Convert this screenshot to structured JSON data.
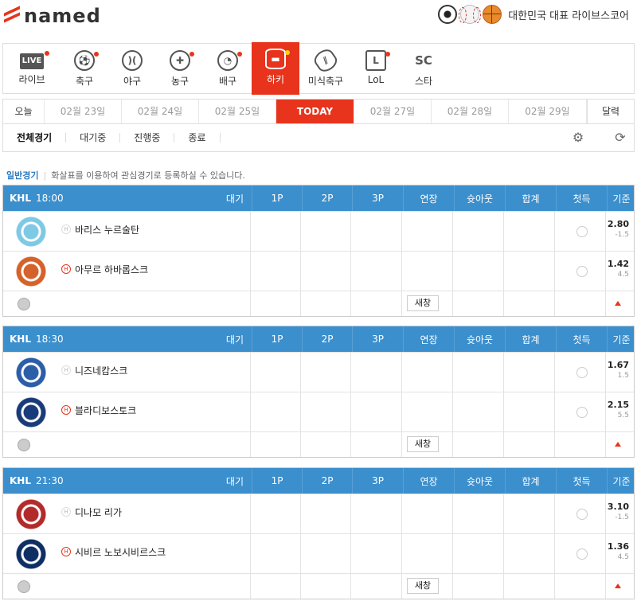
{
  "brand": {
    "logo": "named",
    "tagline": "대한민국 대표 라이브스코어"
  },
  "sports": [
    {
      "label": "라이브",
      "icon": "live-icon",
      "dot": true
    },
    {
      "label": "축구",
      "icon": "soccer-icon",
      "dot": true
    },
    {
      "label": "야구",
      "icon": "baseball-icon",
      "dot": false
    },
    {
      "label": "농구",
      "icon": "basketball-icon",
      "dot": true
    },
    {
      "label": "배구",
      "icon": "volleyball-icon",
      "dot": true
    },
    {
      "label": "하키",
      "icon": "hockey-icon",
      "dot": true,
      "active": true
    },
    {
      "label": "미식축구",
      "icon": "football-icon",
      "dot": false
    },
    {
      "label": "LoL",
      "icon": "lol-icon",
      "dot": true
    },
    {
      "label": "스타",
      "icon": "starcraft-icon",
      "dot": false
    }
  ],
  "live_badge": "LIVE",
  "dates": [
    "오늘",
    "02월 23일",
    "02월 24일",
    "02월 25일",
    "TODAY",
    "02월 27일",
    "02월 28일",
    "02월 29일",
    "달력"
  ],
  "filters": [
    "전체경기",
    "대기중",
    "진행중",
    "종료"
  ],
  "notice": {
    "title": "일반경기",
    "text": "화살표를 이용하여 관심경기로 등록하실 수 있습니다."
  },
  "columns": [
    "대기",
    "1P",
    "2P",
    "3P",
    "연장",
    "슛아웃",
    "합계",
    "첫득",
    "기준"
  ],
  "new_label": "새창",
  "matches": [
    {
      "league": "KHL",
      "time": "18:00",
      "teams": [
        {
          "name": "바리스 누르술탄",
          "home": false,
          "odd": "2.80",
          "handicap": "-1.5",
          "color": "#7ec9e4"
        },
        {
          "name": "아무르 하바롭스크",
          "home": true,
          "odd": "1.42",
          "handicap": "4.5",
          "color": "#d4622a"
        }
      ]
    },
    {
      "league": "KHL",
      "time": "18:30",
      "teams": [
        {
          "name": "니즈네캄스크",
          "home": false,
          "odd": "1.67",
          "handicap": "1.5",
          "color": "#2c5ea8"
        },
        {
          "name": "블라디보스토크",
          "home": true,
          "odd": "2.15",
          "handicap": "5.5",
          "color": "#1a3b7a"
        }
      ]
    },
    {
      "league": "KHL",
      "time": "21:30",
      "teams": [
        {
          "name": "디나모 리가",
          "home": false,
          "odd": "3.10",
          "handicap": "-1.5",
          "color": "#b32a2a"
        },
        {
          "name": "시비르 노보시비르스크",
          "home": true,
          "odd": "1.36",
          "handicap": "4.5",
          "color": "#0e2f64"
        }
      ]
    }
  ]
}
